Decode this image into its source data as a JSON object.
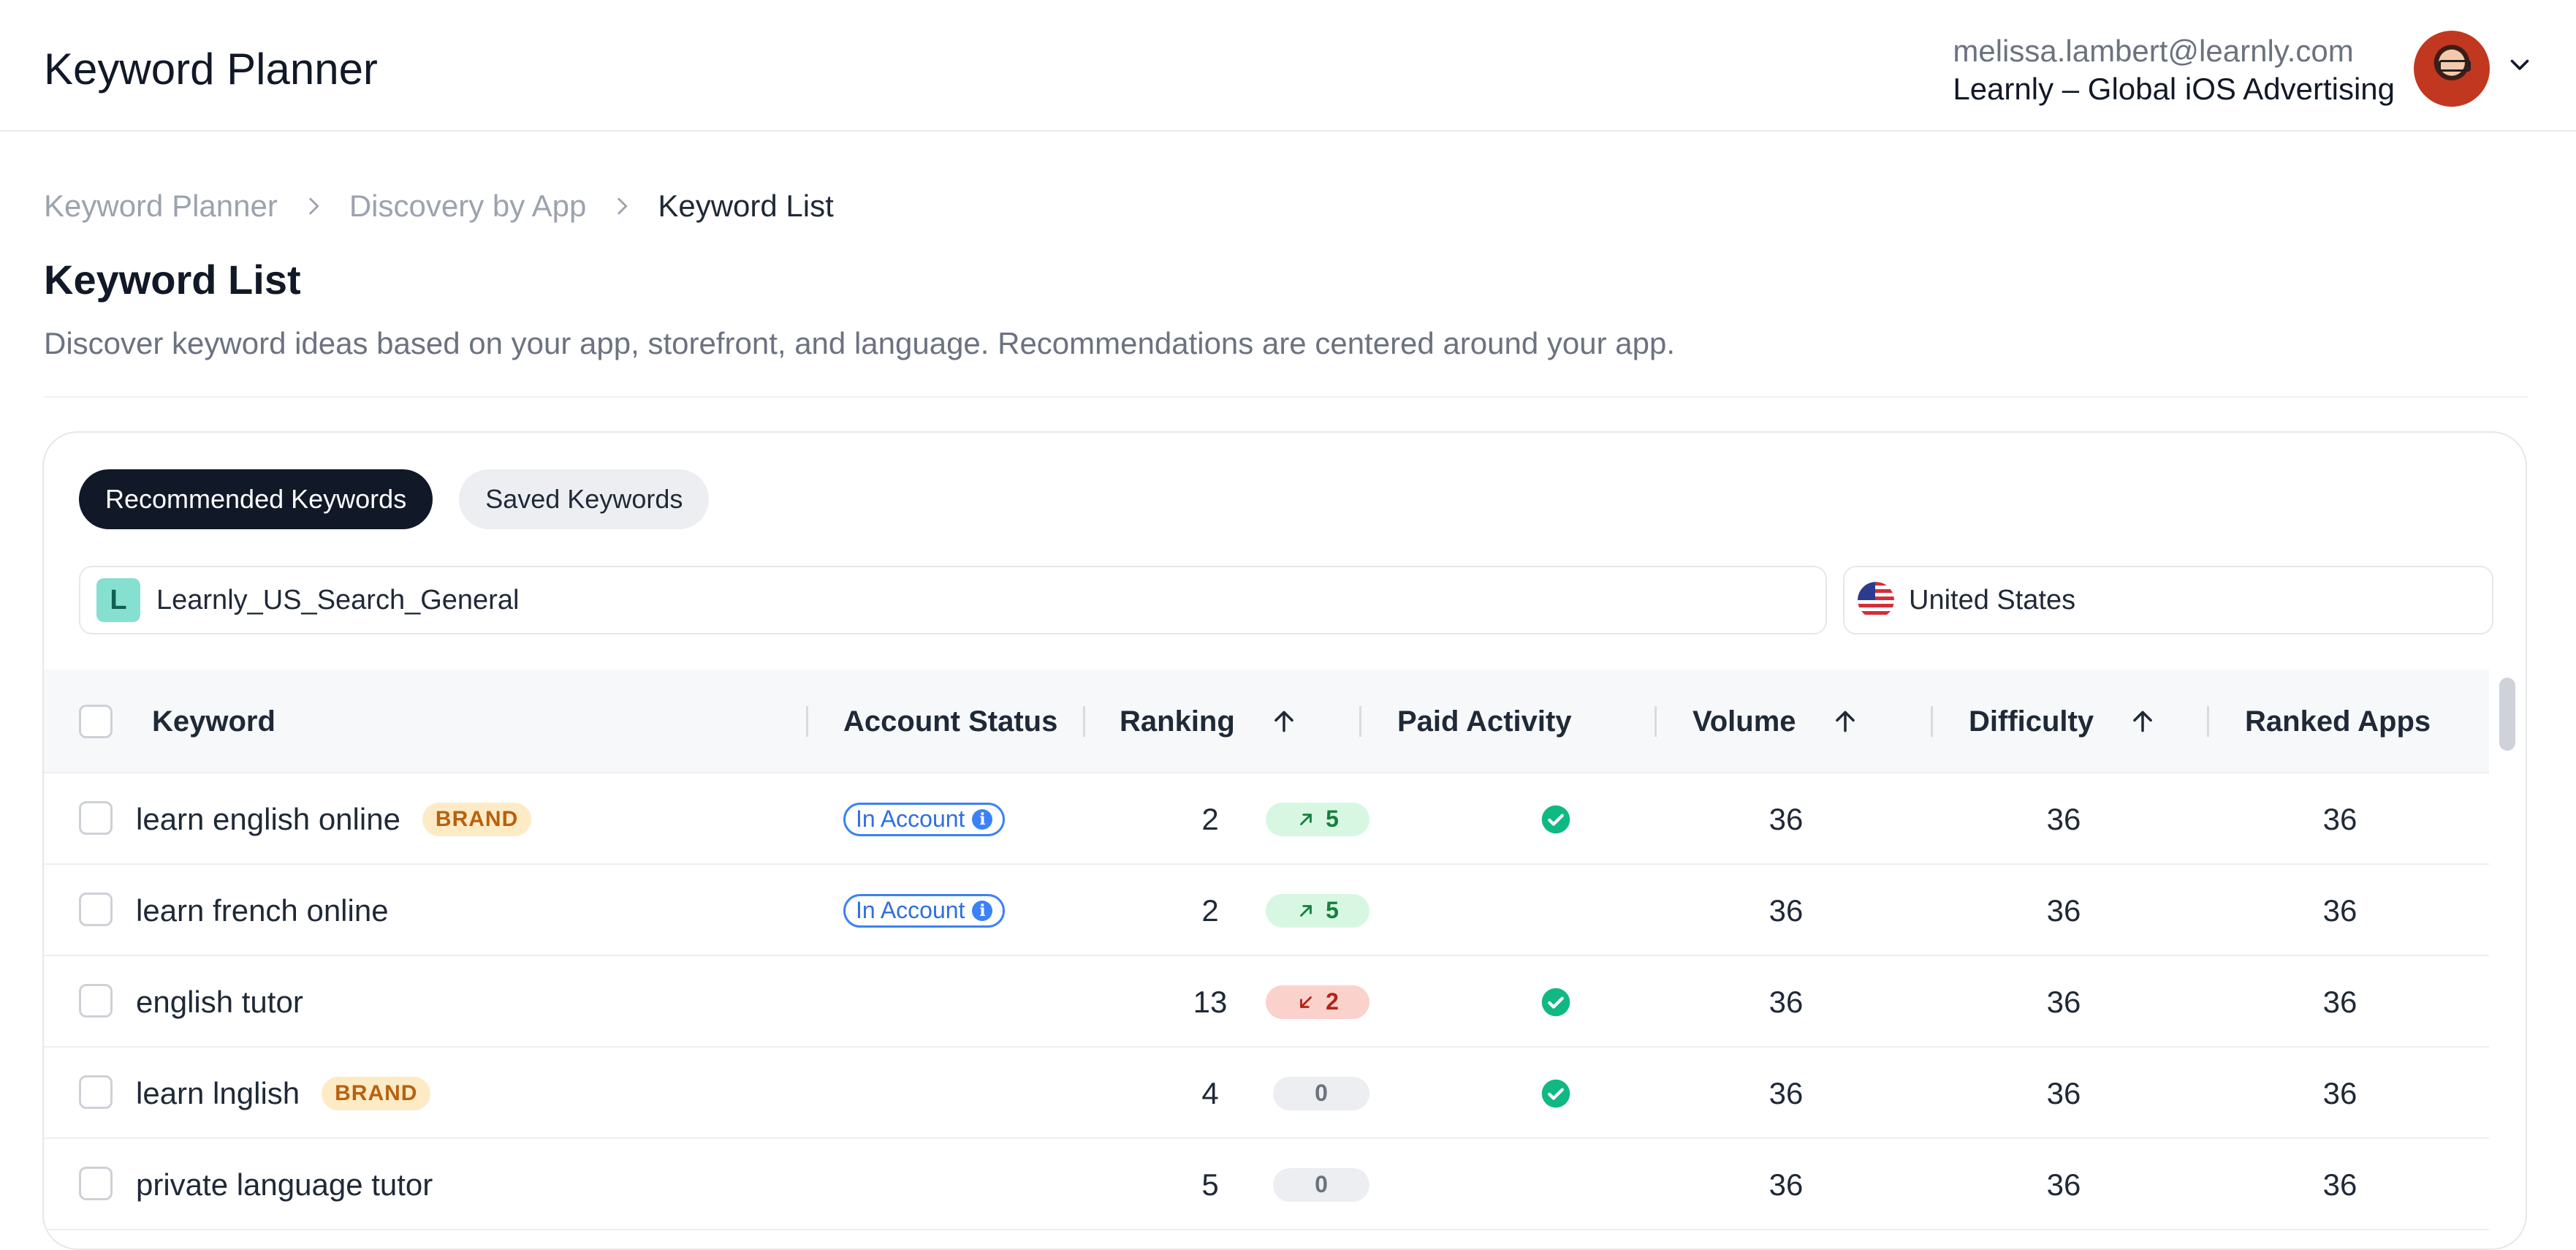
{
  "header": {
    "title": "Keyword Planner",
    "account_email": "melissa.lambert@learnly.com",
    "account_name": "Learnly – Global iOS Advertising"
  },
  "breadcrumb": [
    "Keyword Planner",
    "Discovery by App",
    "Keyword List"
  ],
  "page": {
    "title": "Keyword List",
    "description": "Discover keyword ideas based on your app, storefront, and language. Recommendations are centered around your app."
  },
  "tabs": [
    {
      "label": "Recommended Keywords",
      "active": true
    },
    {
      "label": "Saved Keywords",
      "active": false
    }
  ],
  "campaign": {
    "badge": "L",
    "value": "Learnly_US_Search_General"
  },
  "storefront": {
    "value": "United States"
  },
  "table": {
    "columns": [
      "Keyword",
      "Account Status",
      "Ranking",
      "Paid Activity",
      "Volume",
      "Difficulty",
      "Ranked Apps"
    ],
    "rows": [
      {
        "keyword": "learn english online",
        "brand": "BRAND",
        "status": "In Account",
        "ranking": "2",
        "delta": "5",
        "trend": "up",
        "paid": true,
        "volume": "36",
        "difficulty": "36",
        "ranked_apps": "36"
      },
      {
        "keyword": "learn french online",
        "brand": "",
        "status": "In Account",
        "ranking": "2",
        "delta": "5",
        "trend": "up",
        "paid": false,
        "volume": "36",
        "difficulty": "36",
        "ranked_apps": "36"
      },
      {
        "keyword": "english tutor",
        "brand": "",
        "status": "",
        "ranking": "13",
        "delta": "2",
        "trend": "down",
        "paid": true,
        "volume": "36",
        "difficulty": "36",
        "ranked_apps": "36"
      },
      {
        "keyword": "learn lnglish",
        "brand": "BRAND",
        "status": "",
        "ranking": "4",
        "delta": "0",
        "trend": "zero",
        "paid": true,
        "volume": "36",
        "difficulty": "36",
        "ranked_apps": "36"
      },
      {
        "keyword": "private language tutor",
        "brand": "",
        "status": "",
        "ranking": "5",
        "delta": "0",
        "trend": "zero",
        "paid": false,
        "volume": "36",
        "difficulty": "36",
        "ranked_apps": "36"
      }
    ]
  },
  "colors": {
    "accent": "#111827",
    "status_blue": "#3b82f6",
    "paid_green": "#10b981"
  }
}
